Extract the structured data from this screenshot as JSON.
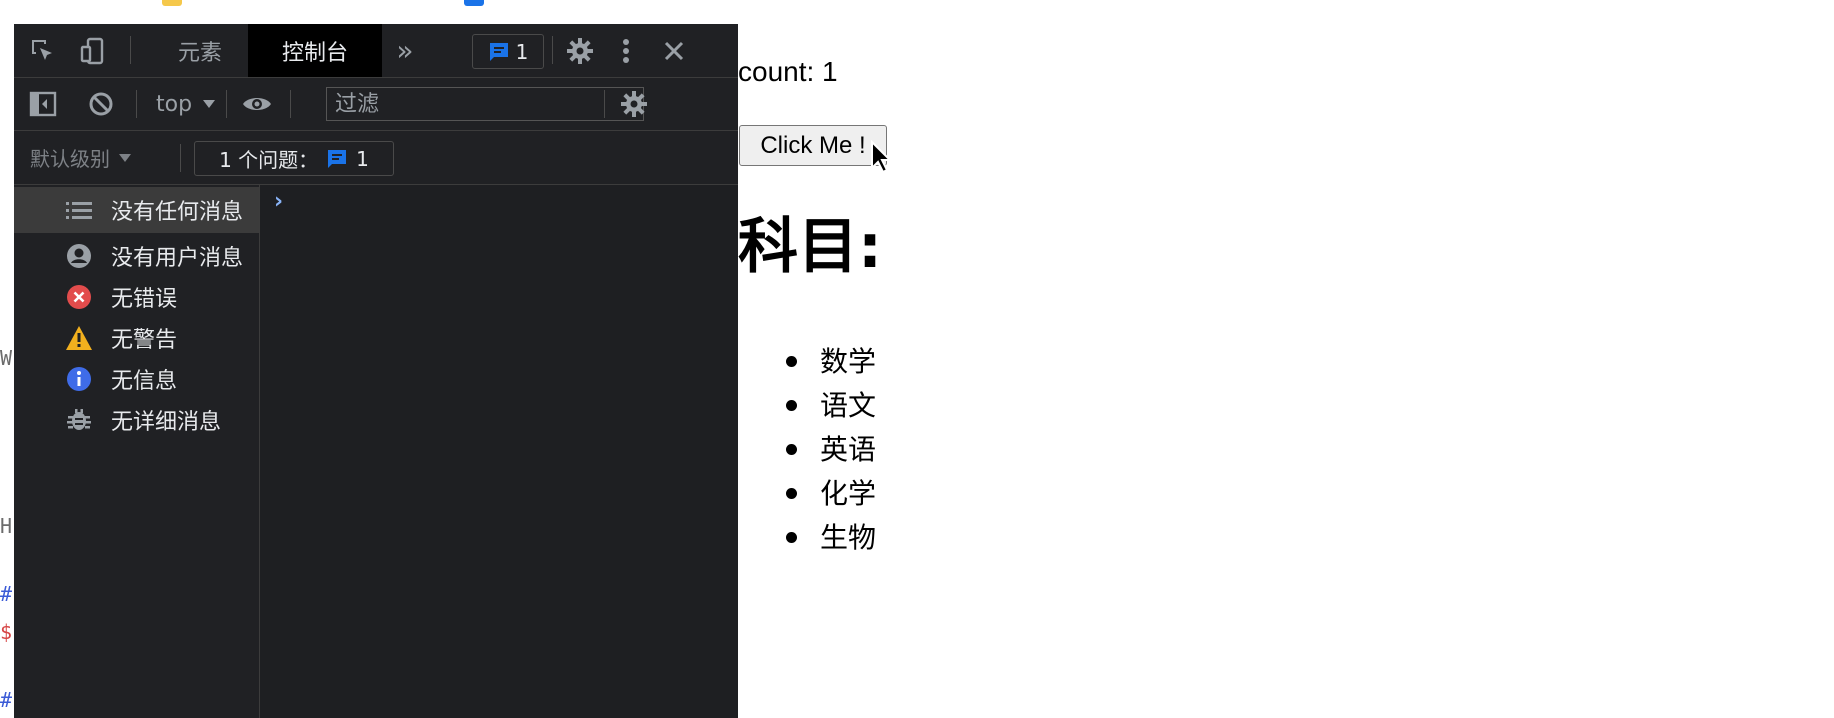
{
  "devtools": {
    "tabs": [
      {
        "label": "元素"
      },
      {
        "label": "控制台"
      }
    ],
    "more_tabs_label": "»",
    "issues_badge_count": "1",
    "context_label": "top",
    "filter_placeholder": "过滤",
    "levels_label": "默认级别",
    "issues_label": "1 个问题：",
    "issues_count": "1",
    "sidebar": [
      {
        "label": "没有任何消息",
        "icon": "list-icon",
        "selected": true
      },
      {
        "label": "没有用户消息",
        "icon": "user-icon"
      },
      {
        "label": "无错误",
        "icon": "error-icon",
        "color": "#e24c4c"
      },
      {
        "label": "无警告",
        "icon": "warning-icon",
        "color": "#f2b01e"
      },
      {
        "label": "无信息",
        "icon": "info-icon",
        "color": "#3f6ce8"
      },
      {
        "label": "无详细消息",
        "icon": "bug-icon"
      }
    ],
    "prompt": "›"
  },
  "editor_edge": [
    "W",
    "H",
    "#",
    "$",
    "#"
  ],
  "page": {
    "count_text": "count: 1",
    "button_label": "Click Me !",
    "heading": "科目:",
    "subjects": [
      "数学",
      "语文",
      "英语",
      "化学",
      "生物"
    ]
  },
  "colors": {
    "devtools_bg": "#202124",
    "accent_blue": "#1a73e8",
    "page_bg": "#ffffff"
  }
}
